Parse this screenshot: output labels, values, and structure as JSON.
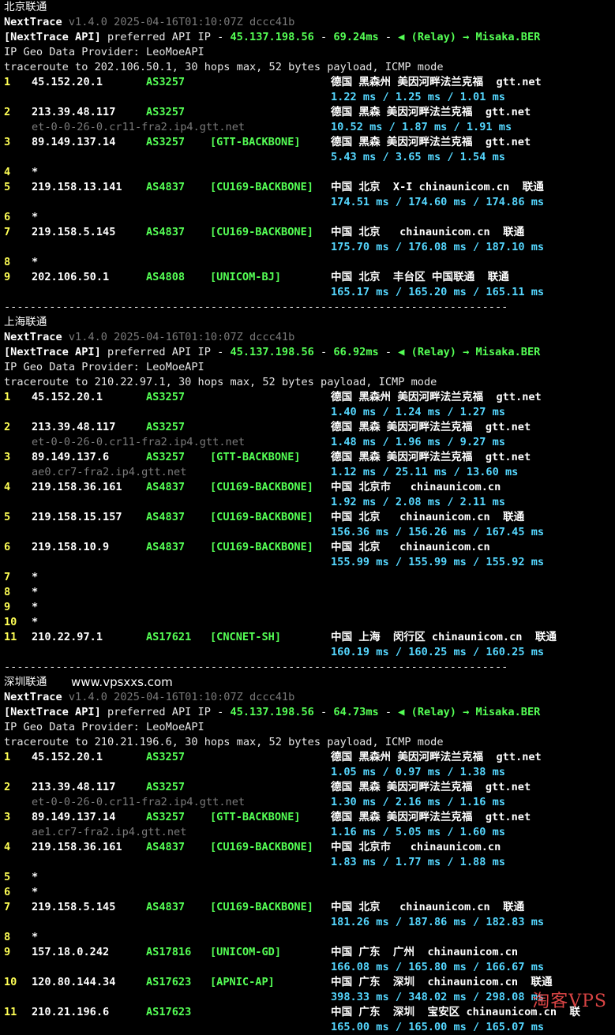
{
  "separator": "------------------------------------------------------------------------------",
  "sections": [
    {
      "title": "北京联通",
      "nt_name": "NextTrace",
      "nt_ver": "v1.4.0 2025-04-16T01:10:07Z dccc41b",
      "api_label": "[NextTrace API]",
      "api_pref": " preferred API IP - ",
      "api_ip": "45.137.198.56",
      "api_dash": " - ",
      "api_ms": "69.24ms",
      "api_relay": "◀ (Relay) → Misaka.BER",
      "geo_provider": "IP Geo Data Provider: LeoMoeAPI",
      "traceroute": "traceroute to 202.106.50.1, 30 hops max, 52 bytes payload, ICMP mode",
      "hops": [
        {
          "n": "1",
          "ip": "45.152.20.1",
          "as": "AS3257",
          "tag": "",
          "geo": "德国 黑森州 美因河畔法兰克福  gtt.net",
          "rdns": "",
          "rtt": "1.22 ms / 1.25 ms / 1.01 ms"
        },
        {
          "n": "2",
          "ip": "213.39.48.117",
          "as": "AS3257",
          "tag": "",
          "geo": "德国 黑森 美因河畔法兰克福  gtt.net",
          "rdns": "et-0-0-26-0.cr11-fra2.ip4.gtt.net",
          "rtt": "10.52 ms / 1.87 ms / 1.91 ms"
        },
        {
          "n": "3",
          "ip": "89.149.137.14",
          "as": "AS3257",
          "tag": "[GTT-BACKBONE]",
          "geo": "德国 黑森 美因河畔法兰克福  gtt.net",
          "rdns": "",
          "rtt": "5.43 ms / 3.65 ms / 1.54 ms"
        },
        {
          "n": "4",
          "ip": "*",
          "as": "",
          "tag": "",
          "geo": "",
          "rdns": "",
          "rtt": ""
        },
        {
          "n": "5",
          "ip": "219.158.13.141",
          "as": "AS4837",
          "tag": "[CU169-BACKBONE]",
          "geo": "中国 北京  X-I chinaunicom.cn  联通",
          "rdns": "",
          "rtt": "174.51 ms / 174.60 ms / 174.86 ms"
        },
        {
          "n": "6",
          "ip": "*",
          "as": "",
          "tag": "",
          "geo": "",
          "rdns": "",
          "rtt": ""
        },
        {
          "n": "7",
          "ip": "219.158.5.145",
          "as": "AS4837",
          "tag": "[CU169-BACKBONE]",
          "geo": "中国 北京   chinaunicom.cn  联通",
          "rdns": "",
          "rtt": "175.70 ms / 176.08 ms / 187.10 ms"
        },
        {
          "n": "8",
          "ip": "*",
          "as": "",
          "tag": "",
          "geo": "",
          "rdns": "",
          "rtt": ""
        },
        {
          "n": "9",
          "ip": "202.106.50.1",
          "as": "AS4808",
          "tag": "[UNICOM-BJ]",
          "geo": "中国 北京  丰台区 中国联通  联通",
          "rdns": "",
          "rtt": "165.17 ms / 165.20 ms / 165.11 ms"
        }
      ]
    },
    {
      "title": "上海联通",
      "nt_name": "NextTrace",
      "nt_ver": "v1.4.0 2025-04-16T01:10:07Z dccc41b",
      "api_label": "[NextTrace API]",
      "api_pref": " preferred API IP - ",
      "api_ip": "45.137.198.56",
      "api_dash": " - ",
      "api_ms": "66.92ms",
      "api_relay": "◀ (Relay) → Misaka.BER",
      "geo_provider": "IP Geo Data Provider: LeoMoeAPI",
      "traceroute": "traceroute to 210.22.97.1, 30 hops max, 52 bytes payload, ICMP mode",
      "hops": [
        {
          "n": "1",
          "ip": "45.152.20.1",
          "as": "AS3257",
          "tag": "",
          "geo": "德国 黑森州 美因河畔法兰克福  gtt.net",
          "rdns": "",
          "rtt": "1.40 ms / 1.24 ms / 1.27 ms"
        },
        {
          "n": "2",
          "ip": "213.39.48.117",
          "as": "AS3257",
          "tag": "",
          "geo": "德国 黑森 美因河畔法兰克福  gtt.net",
          "rdns": "et-0-0-26-0.cr11-fra2.ip4.gtt.net",
          "rtt": "1.48 ms / 1.96 ms / 9.27 ms"
        },
        {
          "n": "3",
          "ip": "89.149.137.6",
          "as": "AS3257",
          "tag": "[GTT-BACKBONE]",
          "geo": "德国 黑森 美因河畔法兰克福  gtt.net",
          "rdns": "ae0.cr7-fra2.ip4.gtt.net",
          "rtt": "1.12 ms / 25.11 ms / 13.60 ms"
        },
        {
          "n": "4",
          "ip": "219.158.36.161",
          "as": "AS4837",
          "tag": "[CU169-BACKBONE]",
          "geo": "中国 北京市   chinaunicom.cn",
          "rdns": "",
          "rtt": "1.92 ms / 2.08 ms / 2.11 ms"
        },
        {
          "n": "5",
          "ip": "219.158.15.157",
          "as": "AS4837",
          "tag": "[CU169-BACKBONE]",
          "geo": "中国 北京   chinaunicom.cn  联通",
          "rdns": "",
          "rtt": "156.36 ms / 156.26 ms / 167.45 ms"
        },
        {
          "n": "6",
          "ip": "219.158.10.9",
          "as": "AS4837",
          "tag": "[CU169-BACKBONE]",
          "geo": "中国 北京   chinaunicom.cn",
          "rdns": "",
          "rtt": "155.99 ms / 155.99 ms / 155.92 ms"
        },
        {
          "n": "7",
          "ip": "*",
          "as": "",
          "tag": "",
          "geo": "",
          "rdns": "",
          "rtt": "",
          "compact": true
        },
        {
          "n": "8",
          "ip": "*",
          "as": "",
          "tag": "",
          "geo": "",
          "rdns": "",
          "rtt": "",
          "compact": true
        },
        {
          "n": "9",
          "ip": "*",
          "as": "",
          "tag": "",
          "geo": "",
          "rdns": "",
          "rtt": "",
          "compact": true
        },
        {
          "n": "10",
          "ip": "*",
          "as": "",
          "tag": "",
          "geo": "",
          "rdns": "",
          "rtt": "",
          "compact": true
        },
        {
          "n": "11",
          "ip": "210.22.97.1",
          "as": "AS17621",
          "tag": "[CNCNET-SH]",
          "geo": "中国 上海  闵行区 chinaunicom.cn  联通",
          "rdns": "",
          "rtt": "160.19 ms / 160.25 ms / 160.25 ms"
        }
      ]
    },
    {
      "title": "深圳联通",
      "title_extra": "www.vpsxxs.com",
      "nt_name": "NextTrace",
      "nt_ver": "v1.4.0 2025-04-16T01:10:07Z dccc41b",
      "api_label": "[NextTrace API]",
      "api_pref": " preferred API IP - ",
      "api_ip": "45.137.198.56",
      "api_dash": " - ",
      "api_ms": "64.73ms",
      "api_relay": "◀ (Relay) → Misaka.BER",
      "geo_provider": "IP Geo Data Provider: LeoMoeAPI",
      "traceroute": "traceroute to 210.21.196.6, 30 hops max, 52 bytes payload, ICMP mode",
      "hops": [
        {
          "n": "1",
          "ip": "45.152.20.1",
          "as": "AS3257",
          "tag": "",
          "geo": "德国 黑森州 美因河畔法兰克福  gtt.net",
          "rdns": "",
          "rtt": "1.05 ms / 0.97 ms / 1.38 ms"
        },
        {
          "n": "2",
          "ip": "213.39.48.117",
          "as": "AS3257",
          "tag": "",
          "geo": "德国 黑森 美因河畔法兰克福  gtt.net",
          "rdns": "et-0-0-26-0.cr11-fra2.ip4.gtt.net",
          "rtt": "1.30 ms / 2.16 ms / 1.16 ms"
        },
        {
          "n": "3",
          "ip": "89.149.137.14",
          "as": "AS3257",
          "tag": "[GTT-BACKBONE]",
          "geo": "德国 黑森 美因河畔法兰克福  gtt.net",
          "rdns": "ae1.cr7-fra2.ip4.gtt.net",
          "rtt": "1.16 ms / 5.05 ms / 1.60 ms"
        },
        {
          "n": "4",
          "ip": "219.158.36.161",
          "as": "AS4837",
          "tag": "[CU169-BACKBONE]",
          "geo": "中国 北京市   chinaunicom.cn",
          "rdns": "",
          "rtt": "1.83 ms / 1.77 ms / 1.88 ms"
        },
        {
          "n": "5",
          "ip": "*",
          "as": "",
          "tag": "",
          "geo": "",
          "rdns": "",
          "rtt": "",
          "compact": true
        },
        {
          "n": "6",
          "ip": "*",
          "as": "",
          "tag": "",
          "geo": "",
          "rdns": "",
          "rtt": ""
        },
        {
          "n": "7",
          "ip": "219.158.5.145",
          "as": "AS4837",
          "tag": "[CU169-BACKBONE]",
          "geo": "中国 北京   chinaunicom.cn  联通",
          "rdns": "",
          "rtt": "181.26 ms / 187.86 ms / 182.83 ms"
        },
        {
          "n": "8",
          "ip": "*",
          "as": "",
          "tag": "",
          "geo": "",
          "rdns": "",
          "rtt": ""
        },
        {
          "n": "9",
          "ip": "157.18.0.242",
          "as": "AS17816",
          "tag": "[UNICOM-GD]",
          "geo": "中国 广东  广州  chinaunicom.cn",
          "rdns": "",
          "rtt": "166.08 ms / 165.80 ms / 166.67 ms"
        },
        {
          "n": "10",
          "ip": "120.80.144.34",
          "as": "AS17623",
          "tag": "[APNIC-AP]",
          "geo": "中国 广东  深圳  chinaunicom.cn  联通",
          "rdns": "",
          "rtt": "398.33 ms / 348.02 ms / 298.08 ms"
        },
        {
          "n": "11",
          "ip": "210.21.196.6",
          "as": "AS17623",
          "tag": "",
          "geo": "中国 广东  深圳  宝安区 chinaunicom.cn  联",
          "rdns": "",
          "rtt": "165.00 ms / 165.00 ms / 165.07 ms"
        }
      ]
    }
  ],
  "watermark": "淘客VPS",
  "colors": {
    "bg": "#000000",
    "yellow": "#ffff55",
    "green": "#55ff55",
    "cyan": "#55d7ff",
    "gray": "#7a7a7a"
  }
}
